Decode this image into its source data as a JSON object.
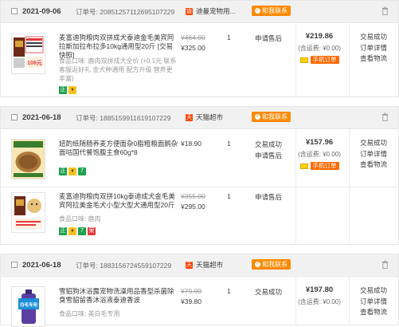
{
  "orders": [
    {
      "date": "2021-09-06",
      "order_label": "订单号:",
      "order_no": "2085125711269510 7229",
      "shop": "迪曼宠物用...",
      "shop_icon": "迪",
      "contact": "和我联系",
      "items": [
        {
          "title": "麦富迪狗粮肉双拼成犬泰迪金毛美宾阿拉斯加拉布拉多10kg通用型20斤 [交易快照]",
          "attr": "食品口味: 鹿肉双拼成犬全价 (+0.1元 联系客服返好礼 金犬种通用 配方升级 营养更丰富)",
          "badges": [
            {
              "t": "正",
              "c": "g"
            },
            {
              "t": "♦",
              "c": "y"
            }
          ],
          "price_old": "¥464.00",
          "price_new": "¥325.00",
          "qty": "1",
          "status": "申请售后",
          "thumb_text": "106元"
        }
      ],
      "total": "¥219.86",
      "ship": "(含运费: ¥0.00)",
      "mobile": "手机订单",
      "actions": [
        "交易成功",
        "订单详情",
        "查看物流"
      ]
    },
    {
      "date": "2021-06-18",
      "order_label": "订单号:",
      "order_no": "1885159911619107229",
      "shop": "天猫超市",
      "shop_icon": "天",
      "contact": "和我联系",
      "items": [
        {
          "title": "妞酌纸随肠养麦方便面杂0脂粗粮面鹅杂面咕国代餐饱腹主食60g*8",
          "attr": "",
          "badges": [
            {
              "t": "正",
              "c": "g"
            },
            {
              "t": "♦",
              "c": "y"
            },
            {
              "t": "7",
              "c": "g"
            }
          ],
          "price_old": "",
          "price_new": "¥18.90",
          "qty": "1",
          "status": "交易成功",
          "status2": "申请售后",
          "thumb_text": ""
        },
        {
          "title": "麦富迪狗粮肉双拼10kg泰迪成犬金毛美宾阿拉美金毛犬小型大型犬通用型20斤",
          "attr": "食品口味: 鹿肉",
          "badges": [
            {
              "t": "正",
              "c": "g"
            },
            {
              "t": "♦",
              "c": "y"
            },
            {
              "t": "7",
              "c": "g"
            },
            {
              "t": "荣",
              "c": "r"
            }
          ],
          "price_old": "¥355.00",
          "price_new": "¥295.00",
          "qty": "1",
          "status": "申请售后",
          "thumb_text": ""
        }
      ],
      "total": "¥157.96",
      "ship": "(含运费: ¥0.00)",
      "mobile": "手机订单",
      "actions": [
        "交易成功",
        "订单详情",
        "查看物流"
      ]
    },
    {
      "date": "2021-06-18",
      "order_label": "订单号:",
      "order_no": "1883156724559107229",
      "shop": "天猫超市",
      "shop_icon": "天",
      "contact": "和我联系",
      "items": [
        {
          "title": "雪貂狗沐浴露宠物洗澡用品香型杀菌除臭雪貂留香沐浴液泰迪香波",
          "attr": "食品口味: 美白毛专用",
          "badges": [],
          "price_old": "¥79.00",
          "price_new": "¥39.80",
          "qty": "1",
          "status": "交易成功",
          "thumb_text": "白毛专用"
        }
      ],
      "total": "¥197.80",
      "ship": "(含运费: ¥0.00)",
      "mobile": "",
      "actions": [
        "交易成功",
        "订单详情",
        "查看物流"
      ]
    }
  ]
}
